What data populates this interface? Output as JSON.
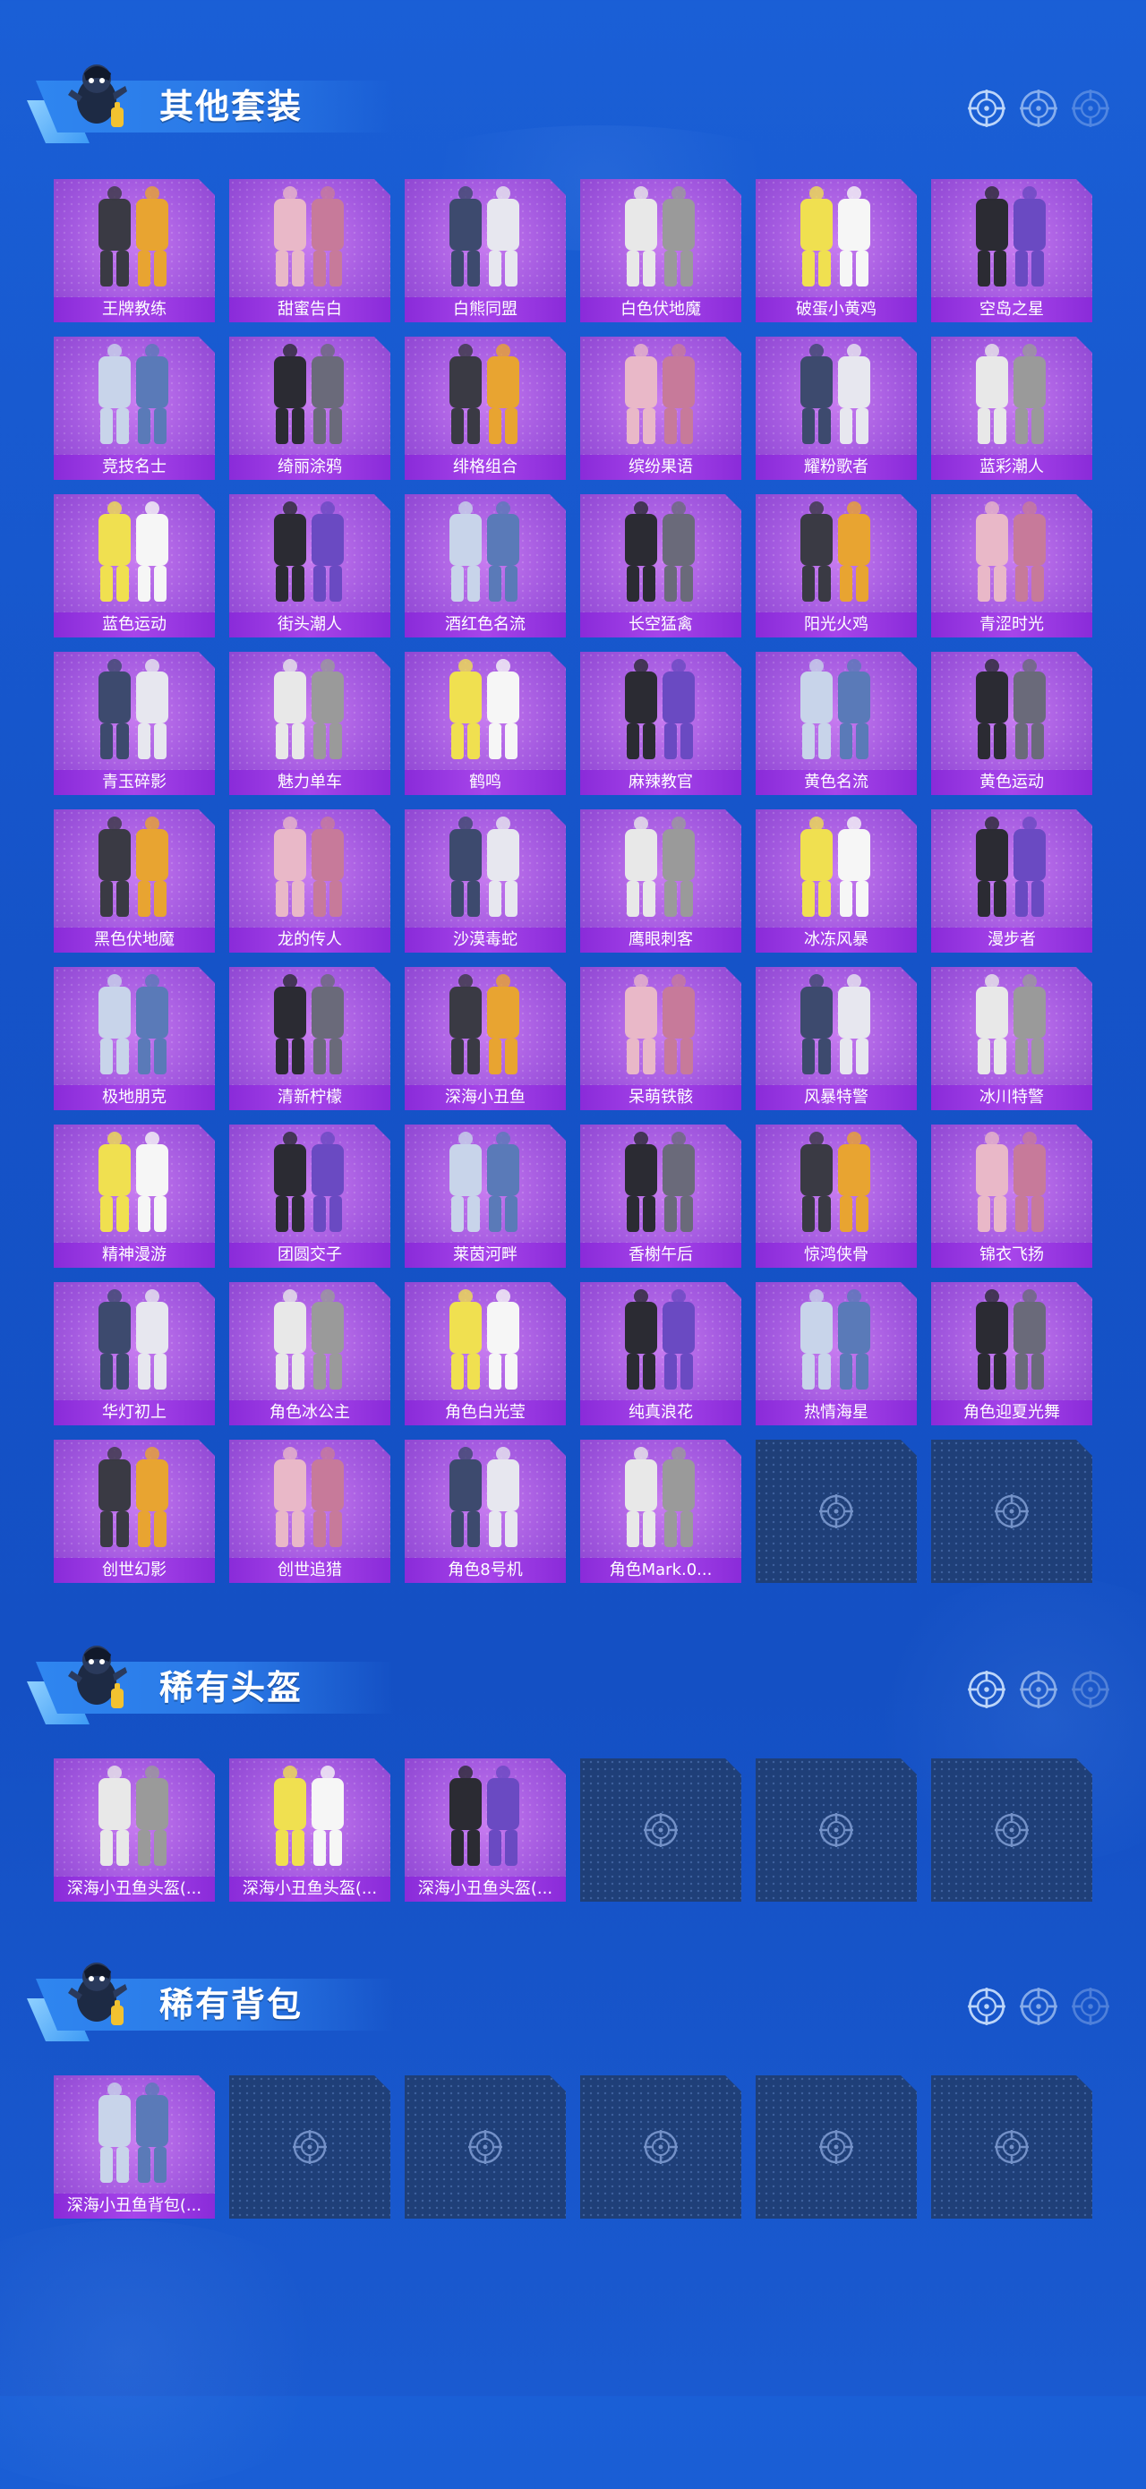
{
  "colors": {
    "background": "#1553c8",
    "card_purple": "#a45ae0",
    "label_purple": "#8a2bd9",
    "empty_card": "#1f3f78"
  },
  "sections": [
    {
      "title": "其他套装",
      "items": [
        "王牌教练",
        "甜蜜告白",
        "白熊同盟",
        "白色伏地魔",
        "破蛋小黄鸡",
        "空岛之星",
        "竞技名士",
        "绮丽涂鸦",
        "绯格组合",
        "缤纷果语",
        "耀粉歌者",
        "蓝彩潮人",
        "蓝色运动",
        "街头潮人",
        "酒红色名流",
        "长空猛禽",
        "阳光火鸡",
        "青涩时光",
        "青玉碎影",
        "魅力单车",
        "鹤鸣",
        "麻辣教官",
        "黄色名流",
        "黄色运动",
        "黑色伏地魔",
        "龙的传人",
        "沙漠毒蛇",
        "鹰眼刺客",
        "冰冻风暴",
        "漫步者",
        "极地朋克",
        "清新柠檬",
        "深海小丑鱼",
        "呆萌铁骸",
        "风暴特警",
        "冰川特警",
        "精神漫游",
        "团圆交子",
        "莱茵河畔",
        "香榭午后",
        "惊鸿侠骨",
        "锦衣飞扬",
        "华灯初上",
        "角色冰公主",
        "角色白光莹",
        "纯真浪花",
        "热情海星",
        "角色迎夏光舞",
        "创世幻影",
        "创世追猎",
        "角色8号机",
        "角色Mark.0..."
      ],
      "empty_slots": 2
    },
    {
      "title": "稀有头盔",
      "items": [
        "深海小丑鱼头盔(...",
        "深海小丑鱼头盔(...",
        "深海小丑鱼头盔(..."
      ],
      "empty_slots": 3
    },
    {
      "title": "稀有背包",
      "items": [
        "深海小丑鱼背包(..."
      ],
      "empty_slots": 5
    }
  ],
  "icons": {
    "section_marker": "crosshair-icon",
    "empty_slot": "crosshair-icon",
    "mascot": "mascot-icon"
  }
}
